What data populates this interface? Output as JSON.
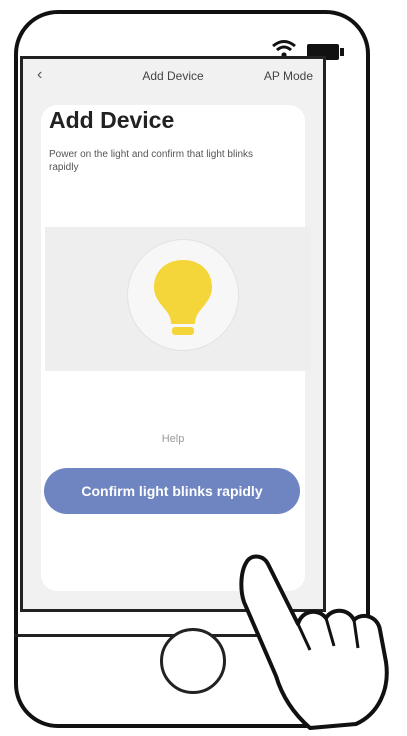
{
  "navbar": {
    "back_icon": "chevron-left-icon",
    "title": "Add Device",
    "mode_label": "AP Mode"
  },
  "content": {
    "title": "Add Device",
    "description": "Power on the light and confirm that light blinks rapidly",
    "illustration_icon": "lightbulb-icon",
    "help_label": "Help",
    "confirm_button_label": "Confirm light blinks rapidly"
  },
  "colors": {
    "button": "#6e85c2",
    "bulb": "#f5d63a",
    "screen_bg": "#f1f1f1"
  }
}
